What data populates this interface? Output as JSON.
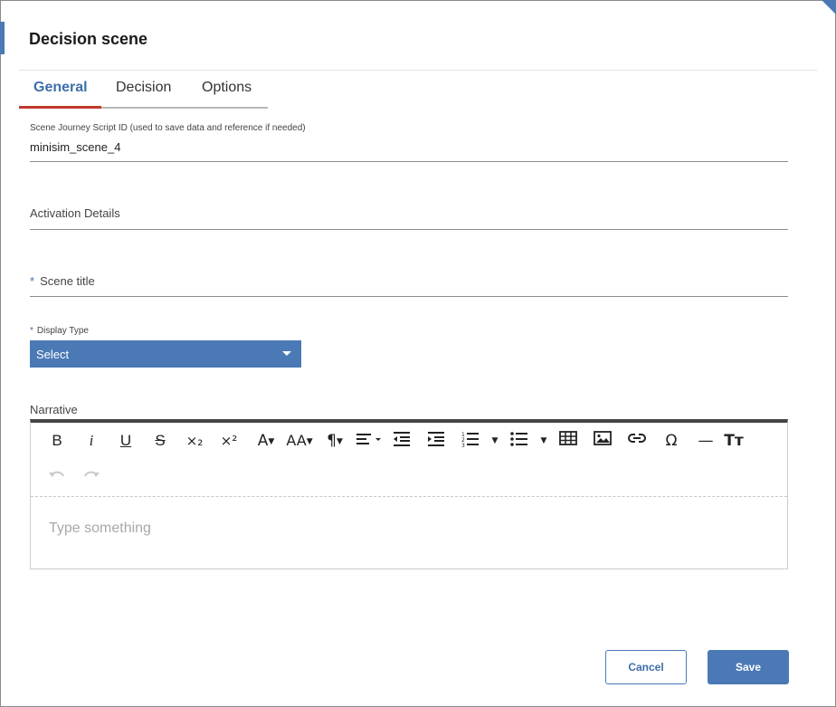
{
  "dialog": {
    "title": "Decision scene"
  },
  "tabs": [
    {
      "label": "General"
    },
    {
      "label": "Decision"
    },
    {
      "label": "Options"
    }
  ],
  "fields": {
    "script_id_label": "Scene Journey Script ID (used to save data and reference if needed)",
    "script_id_value": "minisim_scene_4",
    "activation_label": "Activation Details",
    "scene_title_label": "Scene title",
    "required_marker": "*",
    "display_type_label": "Display Type",
    "display_type_value": "Select",
    "narrative_label": "Narrative"
  },
  "editor": {
    "placeholder": "Type something",
    "toolbar_text": {
      "bold": "B",
      "italic": "i",
      "underline": "U",
      "strike": "S",
      "subscript": "×₂",
      "superscript": "×²",
      "font_color": "A",
      "font_size": "AA",
      "paragraph": "¶",
      "special_char": "Ω",
      "horizontal_line": "—",
      "clear_format": "Tт"
    }
  },
  "buttons": {
    "cancel": "Cancel",
    "save": "Save"
  },
  "colors": {
    "accent": "#4a79b6",
    "active_tab_underline": "#c0392b",
    "editor_top_border": "#444444"
  }
}
